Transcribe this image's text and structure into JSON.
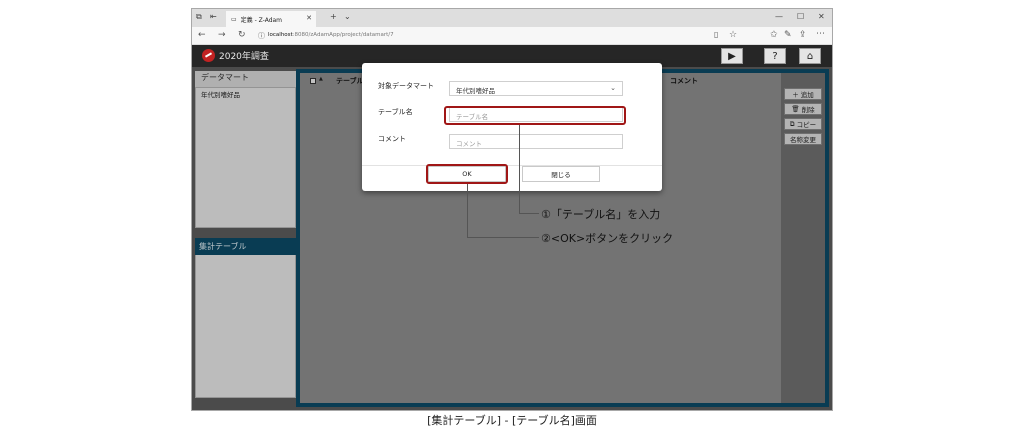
{
  "browser": {
    "tab_title": "定義 - Z-Adam",
    "address": {
      "host": "localhost",
      "path": ":8080/zAdamApp/project/datamart/7"
    }
  },
  "app": {
    "title": "2020年調査"
  },
  "left_panes": {
    "datamart_title": "データマート",
    "datamart_item": "年代別嗜好品",
    "summary_title": "集計テーブル"
  },
  "table_header": {
    "col1": "テーブル",
    "col2": "コメント"
  },
  "side_buttons": {
    "add": "追加",
    "delete": "削除",
    "copy": "コピー",
    "rename": "名称変更"
  },
  "dialog": {
    "target_label": "対象データマート",
    "target_value": "年代別嗜好品",
    "table_name_label": "テーブル名",
    "table_name_placeholder": "テーブル名",
    "comment_label": "コメント",
    "comment_placeholder": "コメント",
    "ok_label": "OK",
    "close_label": "閉じる"
  },
  "callouts": {
    "step1": "①「テーブル名」を入力",
    "step2": "②<OK>ボタンをクリック"
  },
  "caption": "[集計テーブル] - [テーブル名]画面",
  "colors": {
    "header": "#262626",
    "panel_accent": "#0b4a66",
    "highlight": "#a01616"
  }
}
